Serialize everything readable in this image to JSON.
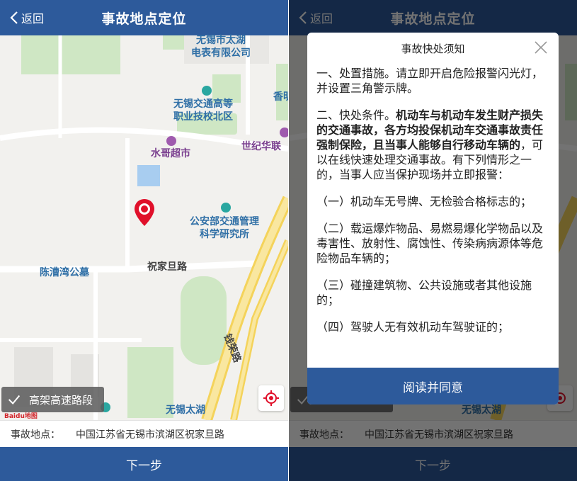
{
  "header": {
    "back_label": "返回",
    "title": "事故地点定位"
  },
  "map": {
    "labels": {
      "company": "无锡市太湖\n电表有限公司",
      "school": "无锡交通高等\n职业技校北区",
      "supermarket": "水哥超市",
      "century": "世纪华联",
      "xiangmen": "香明",
      "institute": "公安部交通管理\n科学研究所",
      "cemetery": "陈漕湾公墓",
      "road_zhujia": "祝家旦路",
      "road_qianrong": "钱荣路",
      "taihu": "无锡太湖"
    },
    "layer_toggle_label": "高架高速路段",
    "layer_toggle_checked": true,
    "baidu_logo": "Baidu地图"
  },
  "address": {
    "label": "事故地点：",
    "value": "中国江苏省无锡市滨湖区祝家旦路"
  },
  "next_label": "下一步",
  "modal": {
    "title": "事故快处须知",
    "p1": "一、处置措施。请立即开启危险报警闪光灯，并设置三角警示牌。",
    "p2_prefix": "二、快处条件。",
    "p2_bold": "机动车与机动车发生财产损失的交通事故，各方均投保机动车交通事故责任强制保险，且当事人能够自行移动车辆的",
    "p2_suffix": "，可以在线快速处理交通事故。有下列情形之一的，当事人应当保护现场并立即报警：",
    "p3": "（一）机动车无号牌、无检验合格标志的；",
    "p4": "（二）载运爆炸物品、易燃易爆化学物品以及毒害性、放射性、腐蚀性、传染病病源体等危险物品车辆的；",
    "p5": "（三）碰撞建筑物、公共设施或者其他设施的；",
    "p6": "（四）驾驶人无有效机动车驾驶证的；",
    "agree_label": "阅读并同意"
  },
  "colors": {
    "brand_blue": "#2d5a9b",
    "pin_red": "#e0102a",
    "poi_blue": "#2f6fa6"
  }
}
